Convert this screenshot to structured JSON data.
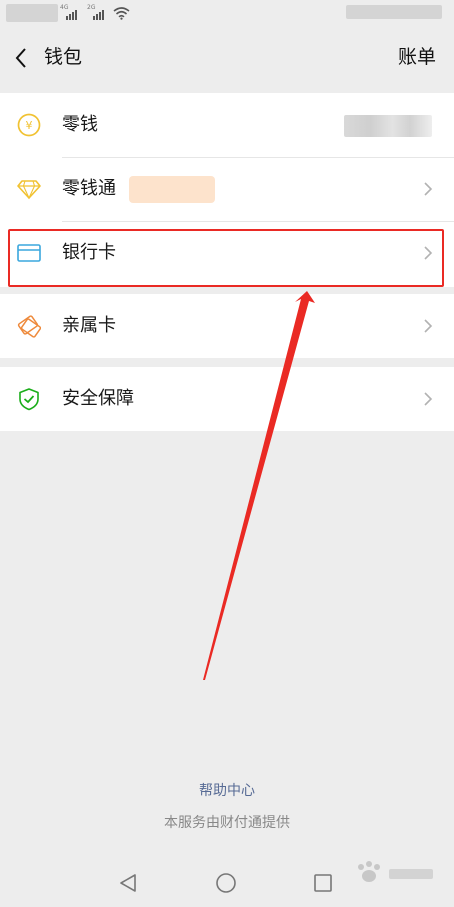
{
  "nav": {
    "title": "钱包",
    "action_label": "账单"
  },
  "wallet": {
    "items": [
      {
        "label": "零钱",
        "icon": "coin-yuan-icon",
        "color": "#f1c232"
      },
      {
        "label": "零钱通",
        "icon": "diamond-icon",
        "color": "#f1c232"
      },
      {
        "label": "银行卡",
        "icon": "bank-card-icon",
        "color": "#3aa7dd"
      },
      {
        "label": "亲属卡",
        "icon": "family-card-icon",
        "color": "#ee8a3c"
      },
      {
        "label": "安全保障",
        "icon": "shield-check-icon",
        "color": "#1aad19"
      }
    ]
  },
  "footer": {
    "help_link": "帮助中心",
    "provider_note": "本服务由财付通提供"
  },
  "annotation": {
    "highlight_color": "#ea2a24"
  },
  "system_nav": {
    "icons": [
      "back-triangle-icon",
      "home-circle-icon",
      "recents-square-icon"
    ]
  }
}
